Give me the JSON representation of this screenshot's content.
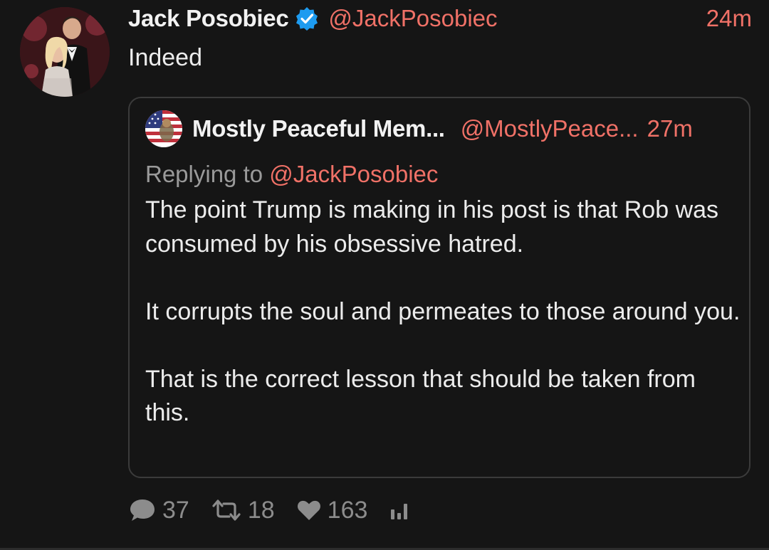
{
  "post": {
    "author_name": "Jack Posobiec",
    "author_handle": "@JackPosobiec",
    "time": "24m",
    "verified_icon": "verified-badge-icon",
    "text": "Indeed"
  },
  "quote": {
    "author_name": "Mostly Peaceful Mem...",
    "author_handle": "@MostlyPeace...",
    "time": "27m",
    "replying_label": "Replying to",
    "replying_handle": "@JackPosobiec",
    "paragraphs": [
      "The point Trump is making in his post is that Rob was consumed by his obsessive hatred.",
      "It corrupts the soul and permeates to those around you.",
      "That is the correct lesson that should be taken from this."
    ]
  },
  "actions": {
    "replies": "37",
    "reposts": "18",
    "likes": "163",
    "reply_icon": "speech-bubble-icon",
    "repost_icon": "repost-arrows-icon",
    "like_icon": "heart-icon",
    "stats_icon": "bar-chart-icon"
  },
  "colors": {
    "background": "#151515",
    "accent": "#f07167",
    "verified": "#1d9bf0",
    "muted": "#8c8c8c"
  }
}
